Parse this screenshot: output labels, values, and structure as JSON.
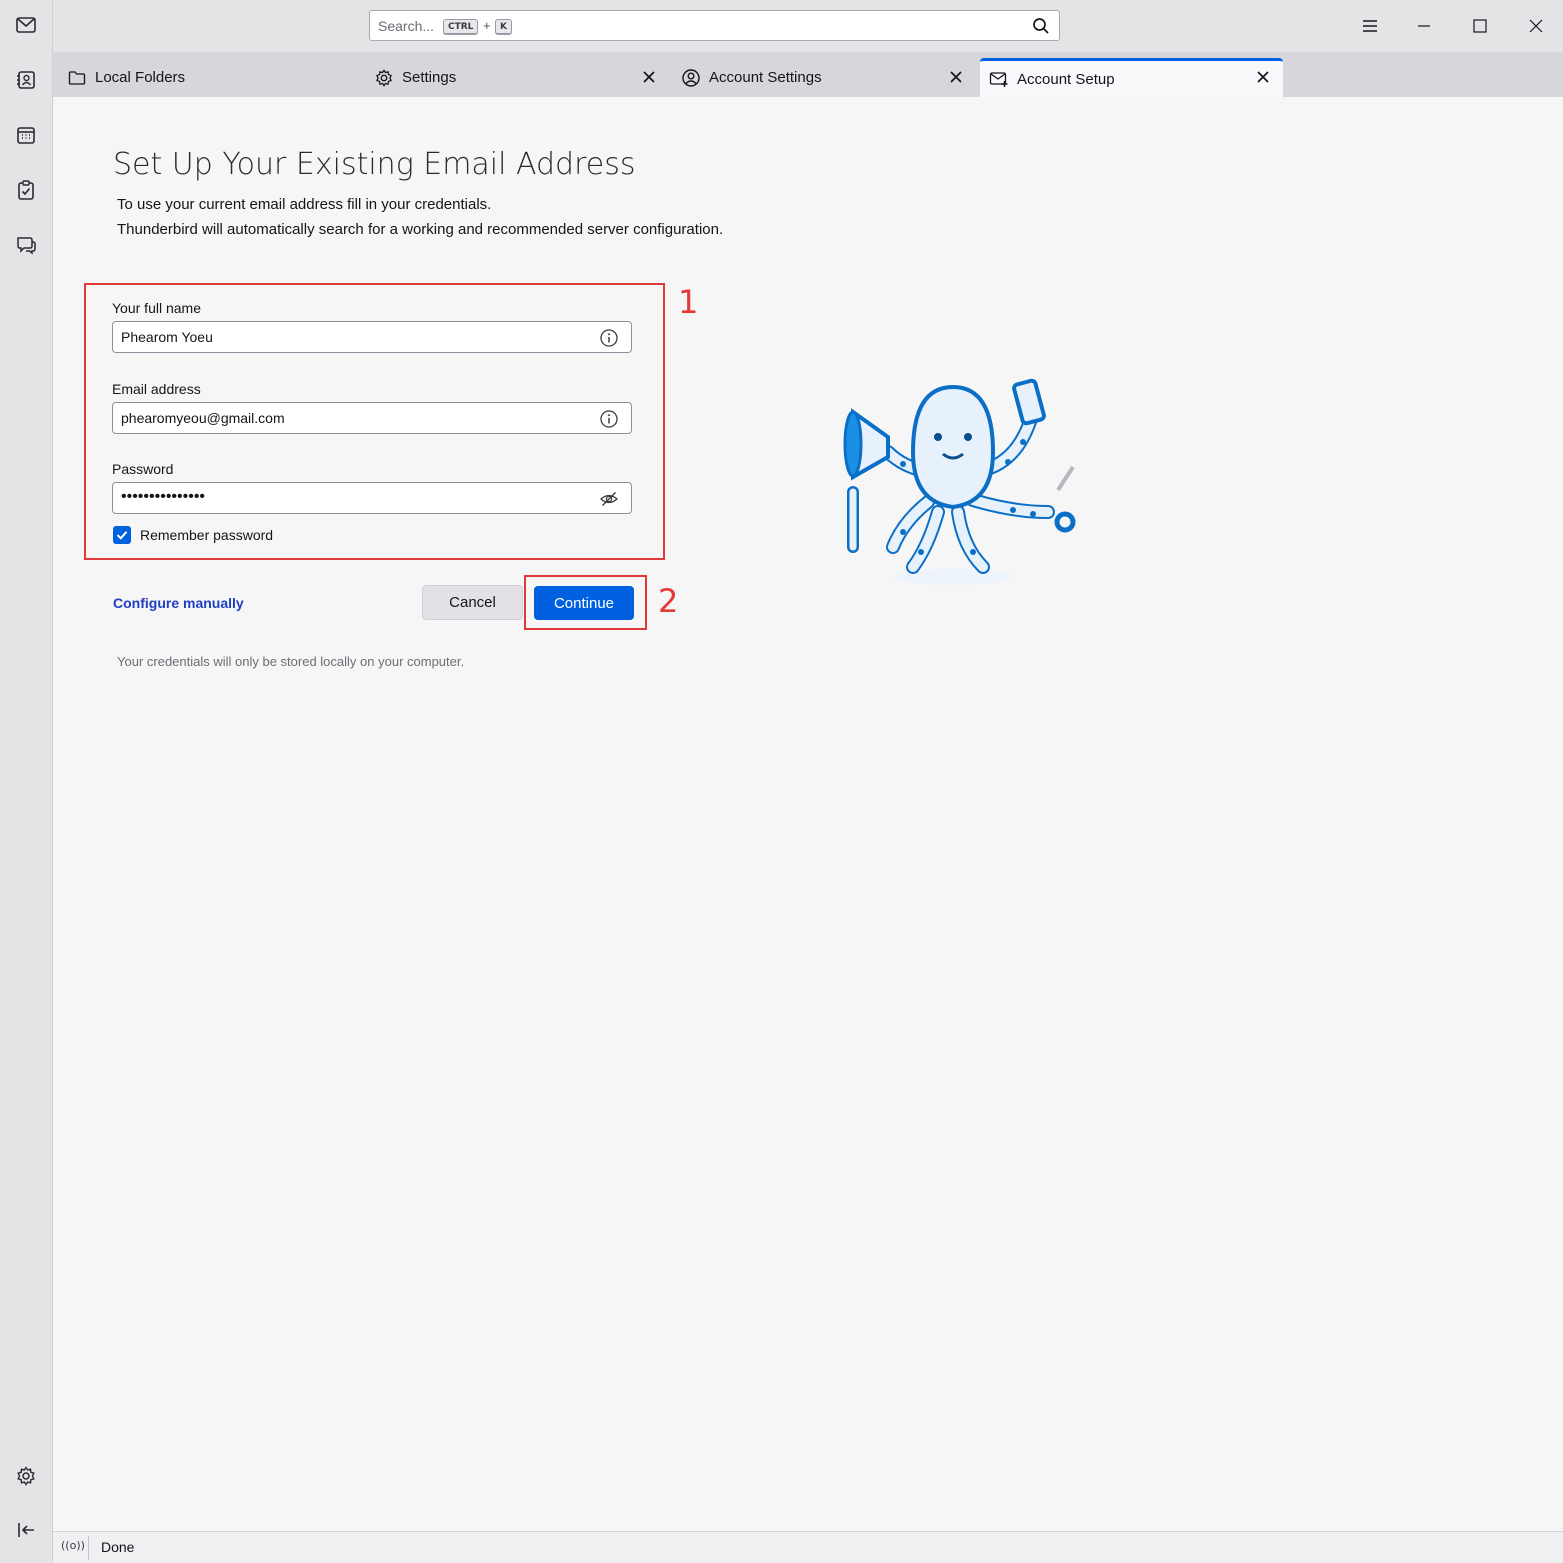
{
  "search": {
    "placeholder": "Search...",
    "kbd_ctrl": "CTRL",
    "kbd_plus": "+",
    "kbd_k": "K"
  },
  "tabs": [
    {
      "label": "Local Folders",
      "icon": "folder-icon"
    },
    {
      "label": "Settings",
      "icon": "gear-icon"
    },
    {
      "label": "Account Settings",
      "icon": "account-icon"
    },
    {
      "label": "Account Setup",
      "icon": "mail-setup-icon"
    }
  ],
  "setup": {
    "title": "Set Up Your Existing Email Address",
    "desc_line1": "To use your current email address fill in your credentials.",
    "desc_line2": "Thunderbird will automatically search for a working and recommended server configuration.",
    "name_label": "Your full name",
    "name_value": "Phearom Yoeu",
    "email_label": "Email address",
    "email_value": "phearomyeou@gmail.com",
    "password_label": "Password",
    "password_value": "•••••••••••••••",
    "remember_label": "Remember password",
    "remember_checked": true,
    "configure_link": "Configure manually",
    "cancel_label": "Cancel",
    "continue_label": "Continue",
    "note": "Your credentials will only be stored locally on your computer."
  },
  "annotations": {
    "one": "1",
    "two": "2",
    "color": "#e23a3a"
  },
  "status": {
    "text": "Done"
  },
  "colors": {
    "accent": "#0061e0",
    "link": "#1f3fc2"
  }
}
